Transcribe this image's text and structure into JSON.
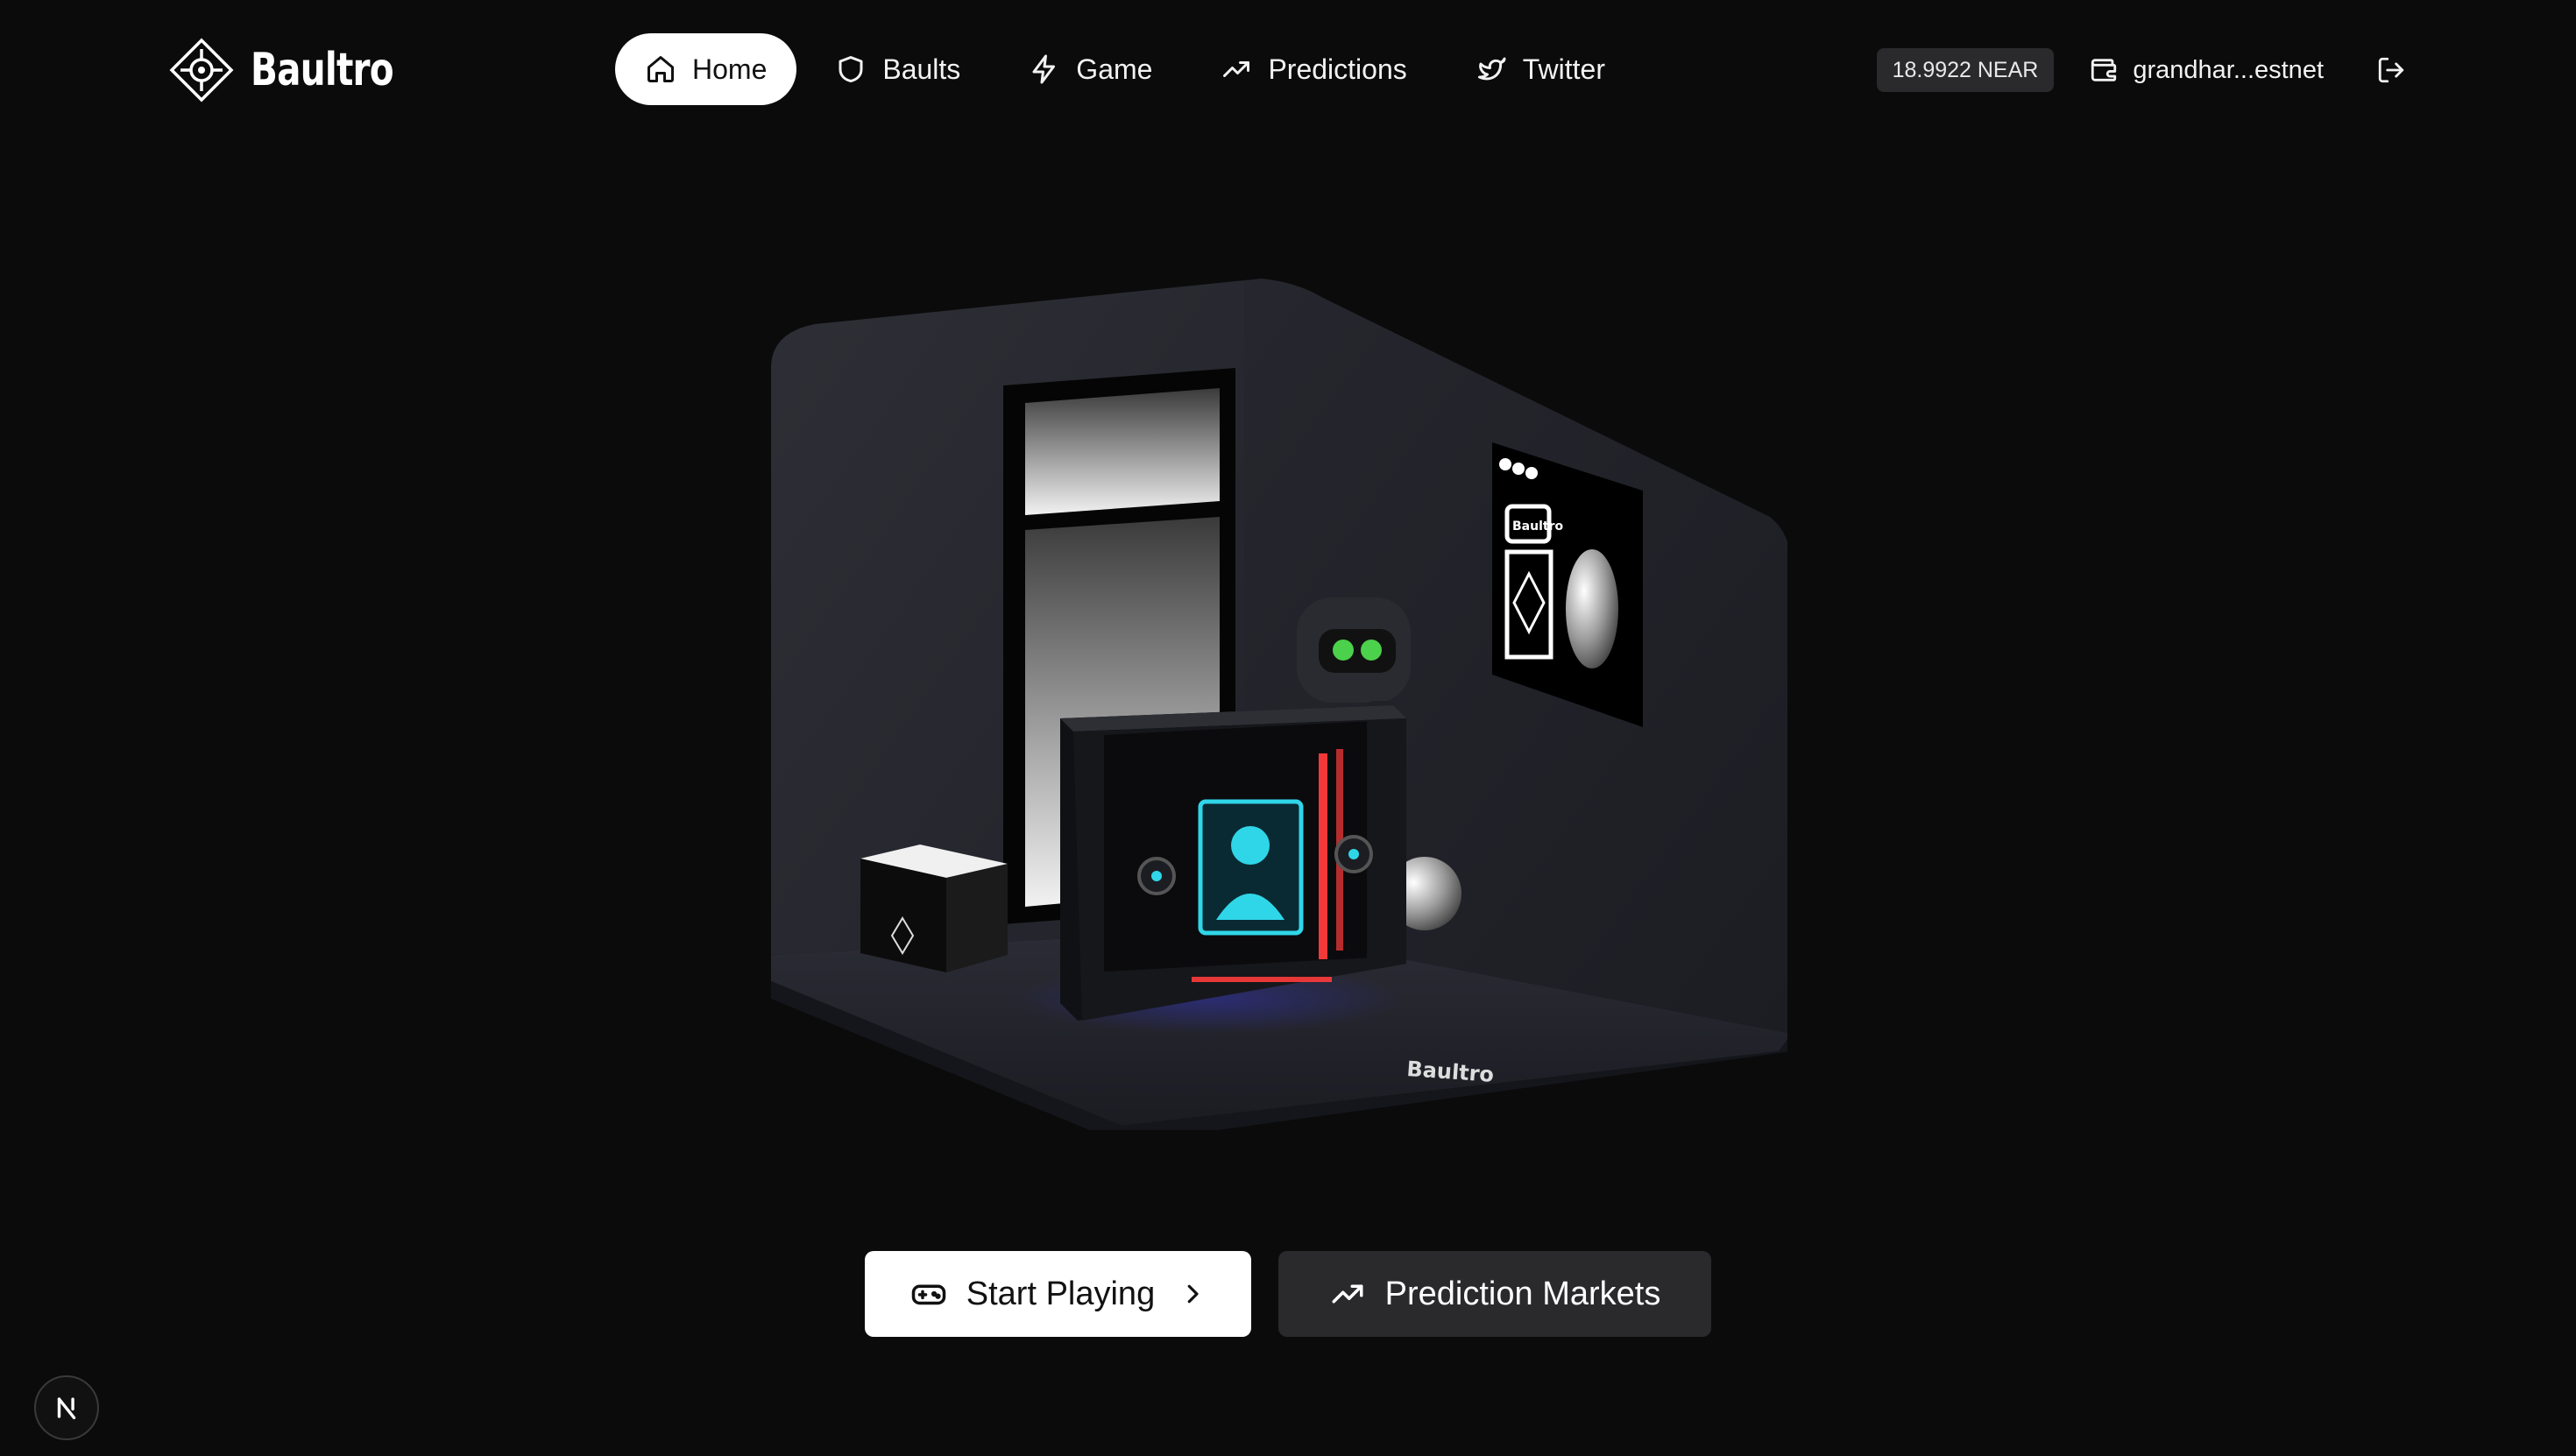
{
  "brand": {
    "name": "Baultro",
    "icon": "baultro-logo-icon"
  },
  "nav": {
    "items": [
      {
        "label": "Home",
        "icon": "home-icon",
        "active": true
      },
      {
        "label": "Baults",
        "icon": "shield-icon",
        "active": false
      },
      {
        "label": "Game",
        "icon": "lightning-icon",
        "active": false
      },
      {
        "label": "Predictions",
        "icon": "trending-up-icon",
        "active": false
      },
      {
        "label": "Twitter",
        "icon": "twitter-icon",
        "active": false
      }
    ]
  },
  "account": {
    "balance": "18.9922 NEAR",
    "wallet_label": "grandhar...estnet",
    "wallet_icon": "wallet-icon",
    "logout_icon": "logout-icon"
  },
  "hero": {
    "floor_label": "Baultro",
    "panel_label": "Baultro"
  },
  "cta": {
    "primary_label": "Start Playing",
    "primary_icon": "gamepad-icon",
    "secondary_label": "Prediction Markets",
    "secondary_icon": "trending-up-icon"
  },
  "dev_badge": {
    "label": "N",
    "icon": "nextjs-icon"
  },
  "colors": {
    "background": "#0b0b0c",
    "active_pill": "#ffffff",
    "secondary_button": "#2a2a2d",
    "screen_cyan": "#2fd6e8",
    "neon_red": "#ff3b3b",
    "robot_eye_green": "#4bd14b"
  }
}
